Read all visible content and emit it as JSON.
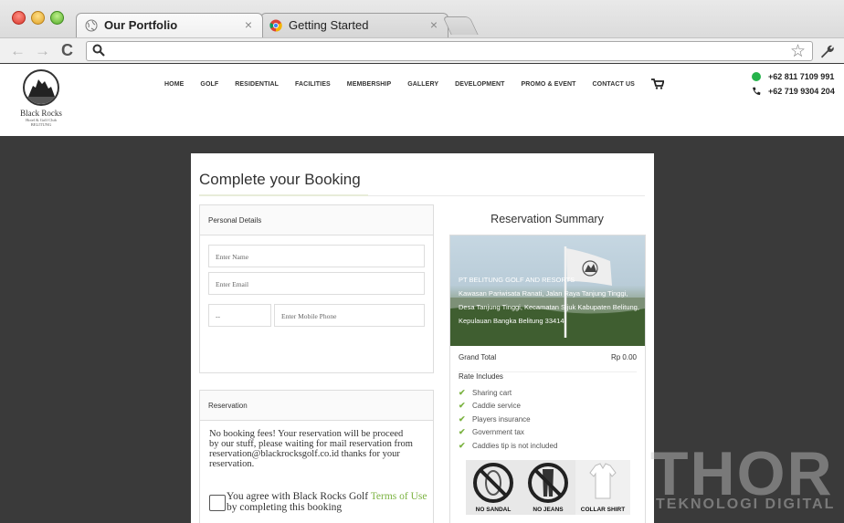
{
  "browser": {
    "tabs": [
      {
        "title": "Our Portfolio",
        "active": true,
        "icon": "globe-icon"
      },
      {
        "title": "Getting Started",
        "active": false,
        "icon": "chrome-icon"
      }
    ],
    "close_glyph": "×",
    "url": "",
    "back_glyph": "←",
    "forward_glyph": "→",
    "reload_glyph": "C",
    "star_glyph": "☆"
  },
  "site": {
    "logo": {
      "name": "Black Rocks",
      "sub1": "Hotel & Golf Club",
      "sub2": "BELITUNG"
    },
    "nav": [
      "HOME",
      "GOLF",
      "RESIDENTIAL",
      "FACILITIES",
      "MEMBERSHIP",
      "GALLERY",
      "DEVELOPMENT",
      "PROMO & EVENT",
      "CONTACT US"
    ],
    "contact": {
      "whatsapp": "+62 811 7109 991",
      "phone": "+62 719 9304 204"
    }
  },
  "booking": {
    "title": "Complete your Booking",
    "personal": {
      "heading": "Personal Details",
      "name_placeholder": "Enter Name",
      "email_placeholder": "Enter Email",
      "country_code": "--",
      "phone_placeholder": "Enter Mobile Phone"
    },
    "reservation": {
      "heading": "Reservation",
      "text": "No booking fees! Your reservation will be proceed by our stuff, please waiting for mail reservation from reservation@blackrocksgolf.co.id thanks for your reservation.",
      "agree_prefix": "You agree with Black Rocks Golf ",
      "terms_label": "Terms of Use",
      "agree_suffix": " by completing this booking"
    },
    "summary": {
      "title": "Reservation Summary",
      "company": "PT BELITUNG GOLF AND RESORTS",
      "address1": "Kawasan Pariwisata Ranati, Jalan Raya Tanjung Tinggi,",
      "address2": "Desa Tanjung Tinggi, Kecamatan Sijuk Kabupaten Belitung, Kepulauan Bangka Belitung 33414",
      "grand_total_label": "Grand Total",
      "grand_total_value": "Rp 0.00",
      "rate_includes_label": "Rate Includes",
      "includes": [
        "Sharing cart",
        "Caddie service",
        "Players insurance",
        "Government tax",
        "Caddies tip is not included"
      ],
      "dress_code": [
        "NO SANDAL",
        "NO JEANS",
        "COLLAR SHIRT"
      ]
    }
  },
  "watermark": {
    "big": "THOR",
    "small": "TEKNOLOGI DIGITAL"
  },
  "colors": {
    "accent_green": "#7cb342",
    "whatsapp_green": "#25b34b",
    "page_bg": "#3a3a3a"
  }
}
